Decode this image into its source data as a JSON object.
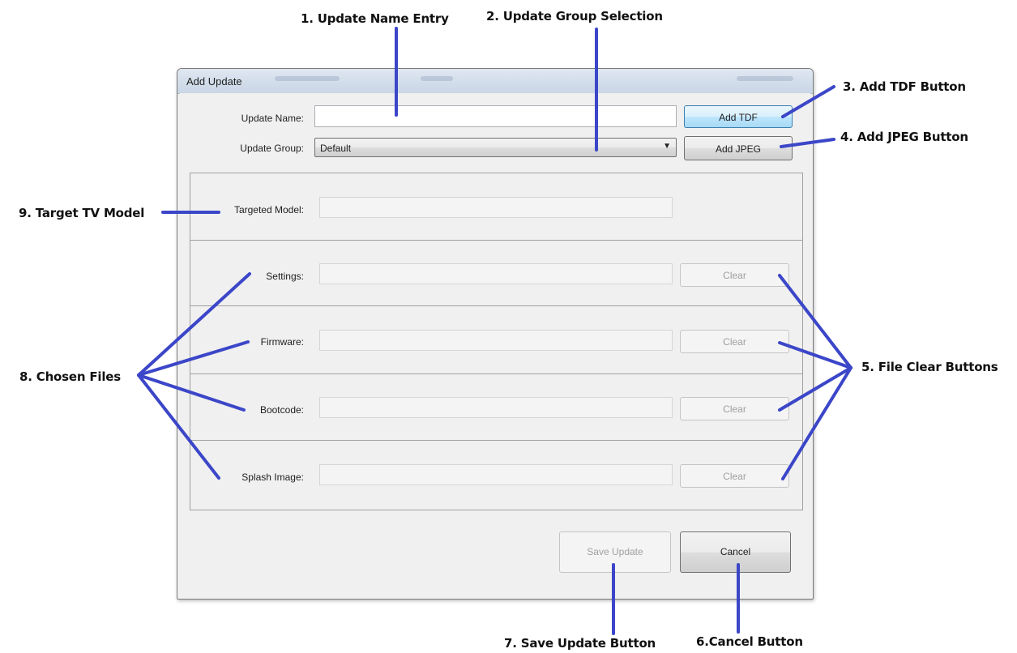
{
  "callouts": {
    "c1": "1. Update Name Entry",
    "c2": "2. Update Group Selection",
    "c3": "3. Add TDF Button",
    "c4": "4. Add JPEG Button",
    "c5": "5. File Clear Buttons",
    "c6": "6.Cancel Button",
    "c7": "7. Save Update Button",
    "c8": "8. Chosen Files",
    "c9": "9. Target TV Model"
  },
  "callout_color": "#3b46c8",
  "dialog": {
    "title": "Add Update",
    "update_name_label": "Update Name:",
    "update_name_value": "",
    "update_group_label": "Update Group:",
    "update_group_value": "Default",
    "add_tdf": "Add TDF",
    "add_jpeg": "Add JPEG",
    "targeted_model_label": "Targeted Model:",
    "targeted_model_value": "",
    "files": [
      {
        "label": "Settings:",
        "value": "",
        "clear": "Clear"
      },
      {
        "label": "Firmware:",
        "value": "",
        "clear": "Clear"
      },
      {
        "label": "Bootcode:",
        "value": "",
        "clear": "Clear"
      },
      {
        "label": "Splash Image:",
        "value": "",
        "clear": "Clear"
      }
    ],
    "save_update": "Save Update",
    "cancel": "Cancel"
  }
}
